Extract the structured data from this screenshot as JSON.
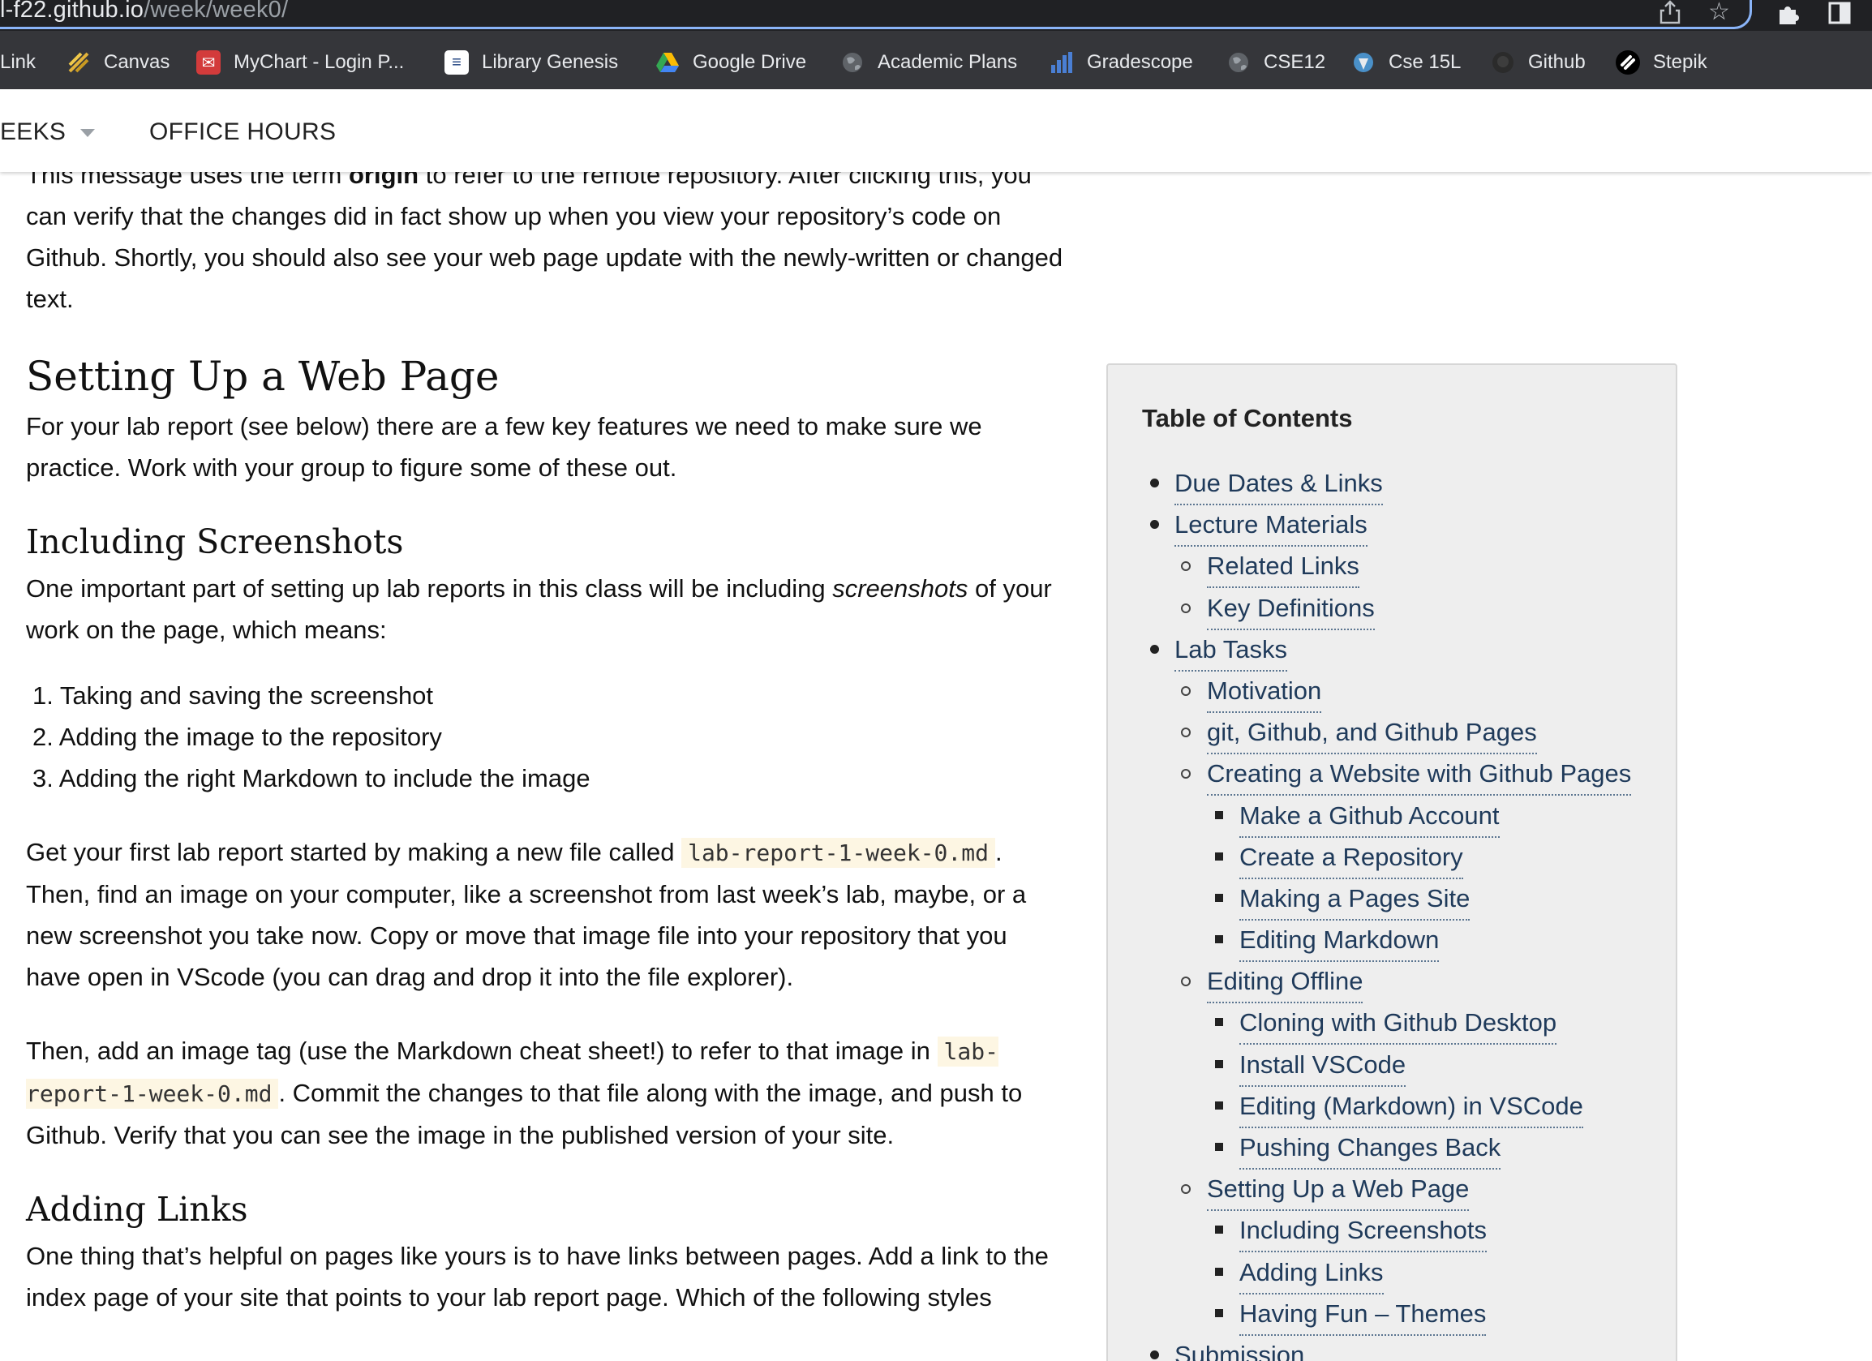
{
  "browser": {
    "url_host": "l-f22.github.io",
    "url_path": "/week/week0/",
    "icons": [
      "share-icon",
      "star-icon",
      "extensions-icon",
      "sidebar-icon"
    ]
  },
  "bookmarks": [
    {
      "label": "Link"
    },
    {
      "label": "Canvas",
      "icon": "canvas-icon",
      "color": "#e2b33a"
    },
    {
      "label": "MyChart - Login P...",
      "icon": "mychart-icon",
      "color": "#d33b3b"
    },
    {
      "label": "Library Genesis",
      "icon": "library-genesis-icon",
      "color": "#ffffff"
    },
    {
      "label": "Google Drive",
      "icon": "google-drive-icon",
      "color": "#34a853"
    },
    {
      "label": "Academic Plans",
      "icon": "globe-icon",
      "color": "#9aa0a6"
    },
    {
      "label": "Gradescope",
      "icon": "gradescope-icon",
      "color": "#4a7fd4"
    },
    {
      "label": "CSE12",
      "icon": "globe-icon",
      "color": "#9aa0a6"
    },
    {
      "label": "Cse 15L",
      "icon": "cse15l-icon",
      "color": "#4a90c8"
    },
    {
      "label": "Github",
      "icon": "github-icon",
      "color": "#2b2b2b"
    },
    {
      "label": "Stepik",
      "icon": "stepik-icon",
      "color": "#000000"
    }
  ],
  "nav": {
    "weeks": "EEKS",
    "office_hours": "OFFICE HOURS"
  },
  "article": {
    "p0a": "This message uses the term ",
    "p0b": "origin",
    "p0c": " to refer to the remote repository. After clicking this, you can verify that the changes did in fact show up when you view your repository’s code on Github. Shortly, you should also see your web page update with the newly-written or changed text.",
    "h_setup": "Setting Up a Web Page",
    "p_setup": "For your lab report (see below) there are a few key features we need to make sure we practice. Work with your group to figure some of these out.",
    "h_screens": "Including Screenshots",
    "p_screens_a": "One important part of setting up lab reports in this class will be including ",
    "p_screens_b": "screenshots",
    "p_screens_c": " of your work on the page, which means:",
    "steps": [
      "1. Taking and saving the screenshot",
      "2. Adding the image to the repository",
      "3. Adding the right Markdown to include the image"
    ],
    "p_lab_a": "Get your first lab report started by making a new file called ",
    "code_file": "lab-report-1-week-0.md",
    "p_lab_b": ". Then, find an image on your computer, like a screenshot from last week’s lab, maybe, or a new screenshot you take now. Copy or move that image file into your repository that you have open in VScode (you can drag and drop it into the file explorer).",
    "p_tag_a": "Then, add an image tag (use the Markdown cheat sheet!) to refer to that image in ",
    "code_file2": "lab-report-1-week-0.md",
    "p_tag_b": ". Commit the changes to that file along with the image, and push to Github. Verify that you can see the image in the published version of your site.",
    "h_links": "Adding Links",
    "p_links": "One thing that’s helpful on pages like yours is to have links between pages. Add a link to the index page of your site that points to your lab report page. Which of the following styles"
  },
  "toc": {
    "title": "Table of Contents",
    "items": [
      {
        "label": "Due Dates & Links",
        "level": 1
      },
      {
        "label": "Lecture Materials",
        "level": 1
      },
      {
        "label": "Related Links",
        "level": 2
      },
      {
        "label": "Key Definitions",
        "level": 2
      },
      {
        "label": "Lab Tasks",
        "level": 1
      },
      {
        "label": "Motivation",
        "level": 2
      },
      {
        "label": "git, Github, and Github Pages",
        "level": 2
      },
      {
        "label": "Creating a Website with Github Pages",
        "level": 2
      },
      {
        "label": "Make a Github Account",
        "level": 3
      },
      {
        "label": "Create a Repository",
        "level": 3
      },
      {
        "label": "Making a Pages Site",
        "level": 3
      },
      {
        "label": "Editing Markdown",
        "level": 3
      },
      {
        "label": "Editing Offline",
        "level": 2
      },
      {
        "label": "Cloning with Github Desktop",
        "level": 3
      },
      {
        "label": "Install VSCode",
        "level": 3
      },
      {
        "label": "Editing (Markdown) in VSCode",
        "level": 3
      },
      {
        "label": "Pushing Changes Back",
        "level": 3
      },
      {
        "label": "Setting Up a Web Page",
        "level": 2
      },
      {
        "label": "Including Screenshots",
        "level": 3
      },
      {
        "label": "Adding Links",
        "level": 3
      },
      {
        "label": "Having Fun – Themes",
        "level": 3
      },
      {
        "label": "Submission",
        "level": 1
      }
    ]
  }
}
